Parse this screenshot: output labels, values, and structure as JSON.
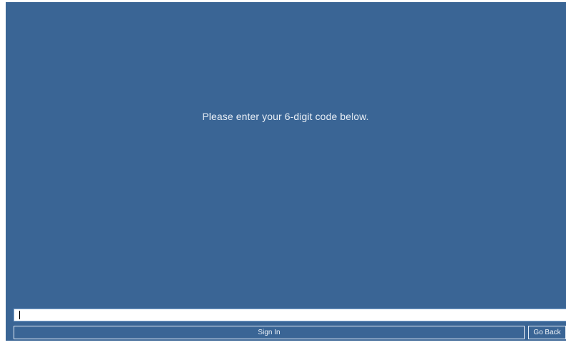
{
  "colors": {
    "background": "#3a6595",
    "prompt_text": "#e9eff6",
    "input_bg": "#ffffff",
    "button_border": "#e4ecf5"
  },
  "prompt": {
    "text": "Please enter your 6-digit code below."
  },
  "code_input": {
    "value": "",
    "placeholder": ""
  },
  "buttons": {
    "sign_in_label": "Sign In",
    "go_back_label": "Go Back"
  }
}
